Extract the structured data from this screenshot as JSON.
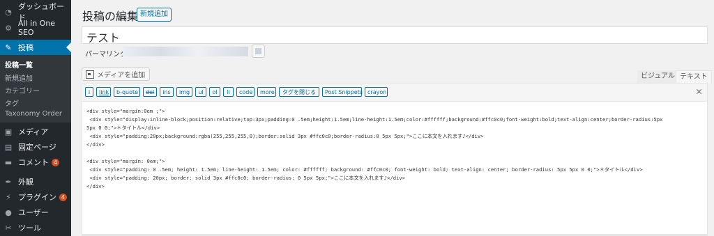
{
  "sidebar": {
    "items": [
      {
        "label": "ダッシュボード",
        "icon": "dashboard-icon"
      },
      {
        "label": "All in One SEO",
        "icon": "gear-icon"
      },
      {
        "label": "投稿",
        "icon": "pin-icon"
      },
      {
        "label": "メディア",
        "icon": "media-icon"
      },
      {
        "label": "固定ページ",
        "icon": "page-icon"
      },
      {
        "label": "コメント",
        "icon": "comment-icon",
        "badge": "4"
      },
      {
        "label": "外観",
        "icon": "brush-icon"
      },
      {
        "label": "プラグイン",
        "icon": "plugin-icon",
        "badge": "4"
      },
      {
        "label": "ユーザー",
        "icon": "user-icon"
      },
      {
        "label": "ツール",
        "icon": "wrench-icon"
      }
    ],
    "submenu": [
      "投稿一覧",
      "新規追加",
      "カテゴリー",
      "タグ",
      "Taxonomy Order"
    ]
  },
  "header": {
    "title": "投稿の編集",
    "add_new": "新規追加"
  },
  "post": {
    "title_value": "テスト",
    "permalink_label": "パーマリンク:"
  },
  "editor": {
    "add_media": "メディアを追加",
    "tab_visual": "ビジュアル",
    "tab_text": "テキスト",
    "toolbar": [
      "i",
      "link",
      "b-quote",
      "del",
      "ins",
      "img",
      "ul",
      "ol",
      "li",
      "code",
      "more",
      "タグを閉じる",
      "Post Snippets",
      "crayon"
    ],
    "content": "<div style=\"margin:0em ;\">\n <div style=\"display:inline-block;position:relative;top:3px;padding:0 .5em;height:1.5em;line-height:1.5em;color:#ffffff;background:#ffc0c0;font-weight:bold;text-align:center;border-radius:5px\n5px 0 0;\">＊タイトル</div>\n <div style=\"padding:20px;background:rgba(255,255,255,0);border:solid 3px #ffc0c0;border-radius:0 5px 5px;\">ここに本文を入れます♪</div>\n</div>\n\n<div style=\"margin: 0em;\">\n <div style=\"padding: 0 .5em; height: 1.5em; line-height: 1.5em; color: #ffffff; background: #ffc0c0; font-weight: bold; text-align: center; border-radius: 5px 5px 0 0;\">＊タイトル</div>\n <div style=\"padding: 20px; border: solid 3px #ffc0c0; border-radius: 0 5px 5px;\">ここに本文を入れます♪</div>\n</div>"
  },
  "colors": {
    "sidebar_bg": "#23282d",
    "active_menu": "#0073aa",
    "badge": "#d54e21",
    "button_blue": "#0071a1"
  }
}
